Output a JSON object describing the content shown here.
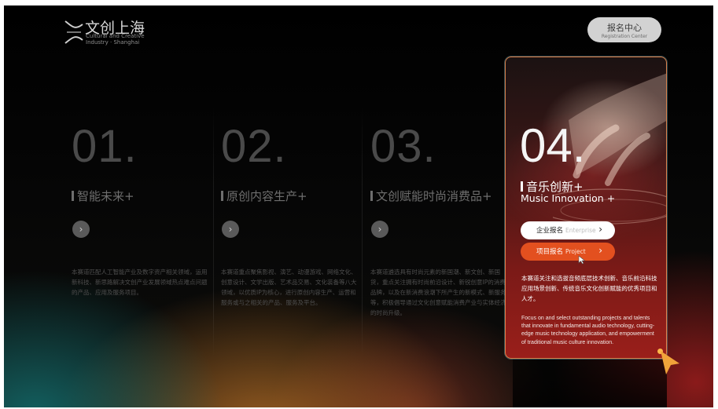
{
  "header": {
    "logo_title": "文创上海",
    "logo_subtitle": "Cultural and Creative Industry · Shanghai",
    "registration_label": "报名中心",
    "registration_sub": "Registration Center"
  },
  "columns": [
    {
      "number": "01.",
      "title": "智能未来+",
      "arrow": "›",
      "description": "本赛道匹配人工智能产业及数字资产相关领域，运用新科技、新思路解决文创产业发展领域热点难点问题的产品、应用及服务项目。"
    },
    {
      "number": "02.",
      "title": "原创内容生产+",
      "arrow": "›",
      "description": "本赛道重点聚焦影视、演艺、动漫游戏、网络文化、创意设计、文学出版、艺术品交易、文化装备等八大领域，以优质IP为核心，进行原创内容生产、运营和服务或与之相关的产品、服务及平台。"
    },
    {
      "number": "03.",
      "title": "文创赋能时尚消费品+",
      "arrow": "›",
      "description": "本赛道遴选具有时尚元素的新国潮、新文创、新国货，重点关注拥有时尚前沿设计、新锐创意IP的消费品牌，以及在新消费浪潮下所产生的新模式、新服务等，积极倡导通过文化创意赋能消费产业与实体经济的时尚升级。"
    }
  ],
  "card": {
    "number": "04.",
    "title": "音乐创新+",
    "title_en": "Music Innovation +",
    "btn_enterprise": "企业报名",
    "btn_enterprise_sub": "Enterprise",
    "btn_project": "项目报名",
    "btn_project_sub": "Project",
    "chevron": "›",
    "description": "本赛道关注和选拔音频底层技术创新、音乐前沿科技应用场景创新、传统音乐文化创新赋能的优秀项目和人才。",
    "description_en": "Focus on and select outstanding projects and talents that innovate in fundamental audio technology, cutting-edge music technology application, and empowerment of traditional music culture innovation."
  },
  "colors": {
    "accent": "#e3501f",
    "card_border": "#eb8c50",
    "cursor": "#ffb74a"
  }
}
